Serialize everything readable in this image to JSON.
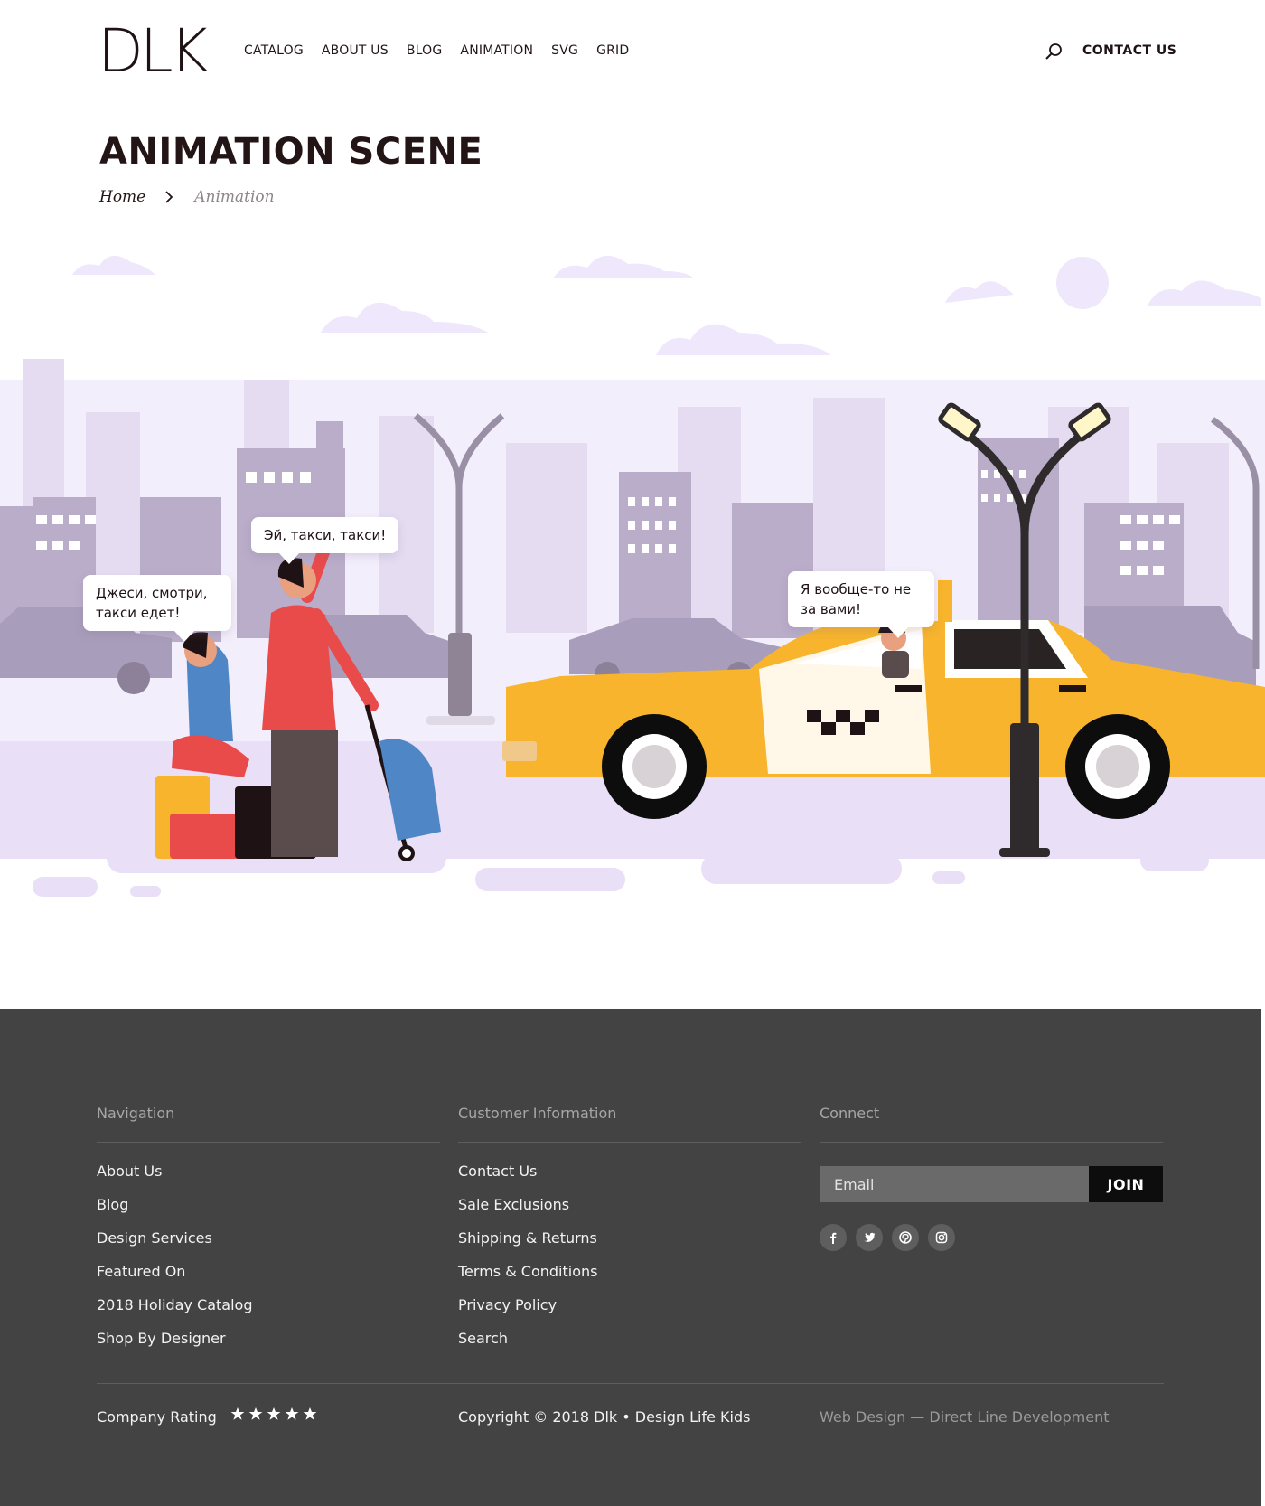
{
  "header": {
    "logo": "DLK",
    "nav": [
      "CATALOG",
      "ABOUT US",
      "BLOG",
      "ANIMATION",
      "SVG",
      "GRID"
    ],
    "contact": "CONTACT  US"
  },
  "page": {
    "title": "ANIMATION SCENE",
    "breadcrumb": {
      "home": "Home",
      "current": "Animation"
    }
  },
  "scene": {
    "bubbles": [
      "Джеси, смотри, такси едет!",
      "Эй, такси, такси!",
      "Я вообще-то не за вами!"
    ],
    "colors": {
      "taxi": "#f7b42c",
      "sky_tint": "#efe7fb",
      "buildings": "#b9adc9",
      "road": "#e9dff7"
    }
  },
  "footer": {
    "navigation": {
      "heading": "Navigation",
      "links": [
        "About Us",
        "Blog",
        "Design Services",
        "Featured On",
        "2018 Holiday Catalog",
        "Shop By Designer"
      ]
    },
    "customer": {
      "heading": "Customer Information",
      "links": [
        "Contact Us",
        "Sale Exclusions",
        "Shipping & Returns",
        "Terms & Conditions",
        "Privacy Policy",
        "Search"
      ]
    },
    "connect": {
      "heading": "Connect",
      "email_placeholder": "Email",
      "join": "JOIN",
      "socials": [
        "facebook-icon",
        "twitter-icon",
        "pinterest-icon",
        "instagram-icon"
      ]
    },
    "rating_label": "Company Rating",
    "rating_stars": 5,
    "copyright": "Copyright © 2018 Dlk • Design Life Kids",
    "credit": "Web Design — Direct Line Development",
    "colors": {
      "background": "#434343",
      "join": "#0d0d0d"
    }
  }
}
